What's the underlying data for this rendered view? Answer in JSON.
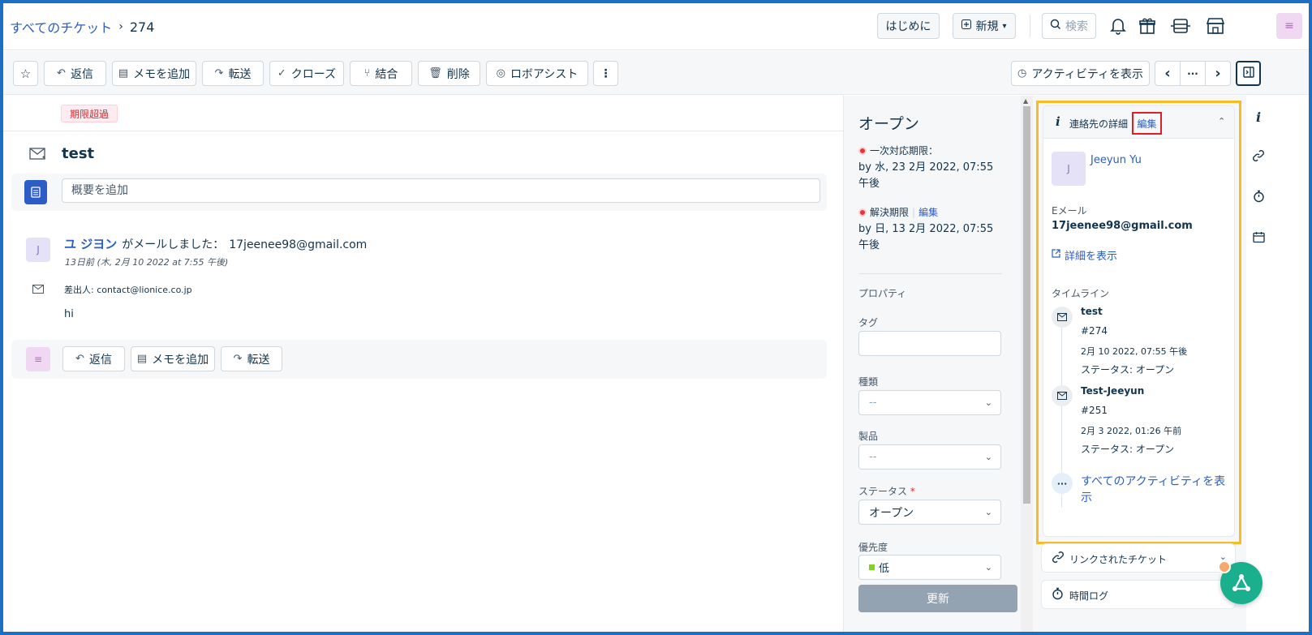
{
  "breadcrumb": {
    "parent": "すべてのチケット",
    "separator": "›",
    "ticket_id": "274"
  },
  "header": {
    "getting_started": "はじめに",
    "new_label": "新規",
    "search_label": "検索",
    "user_initial": "≡"
  },
  "toolbar": {
    "reply": "返信",
    "add_note": "メモを追加",
    "forward": "転送",
    "close": "クローズ",
    "merge": "結合",
    "delete": "削除",
    "robo_assist": "ロボアシスト",
    "more": "⋮",
    "show_activity": "アクティビティを表示",
    "prev": "‹",
    "ellipsis": "···",
    "next": "›"
  },
  "ticket": {
    "overdue_badge": "期限超過",
    "subject": "test",
    "summary_placeholder": "概要を追加"
  },
  "message": {
    "avatar_initial": "J",
    "sender_name": "ユ ジヨン",
    "action_text": "がメールしました：",
    "email": "17jeenee98@gmail.com",
    "timestamp": "13日前 (木, 2月 10 2022 at 7:55 午後)",
    "from_line": "差出人: contact@lionice.co.jp",
    "body": "hi"
  },
  "reply_bar": {
    "avatar_initial": "≡",
    "reply": "返信",
    "add_note": "メモを追加",
    "forward": "転送"
  },
  "properties": {
    "status_heading": "オープン",
    "first_response_label": "一次対応期限：",
    "first_response_value": "by 水, 23 2月 2022, 07:55 午後",
    "resolution_label": "解決期限",
    "resolution_edit": "編集",
    "resolution_value": "by 日, 13 2月 2022, 07:55 午後",
    "section_title": "プロパティ",
    "tags_label": "タグ",
    "type_label": "種類",
    "type_value": "--",
    "product_label": "製品",
    "product_value": "--",
    "status_label": "ステータス",
    "required_mark": "*",
    "status_value": "オープン",
    "priority_label": "優先度",
    "priority_value": "低",
    "priority_color": "#7ed321",
    "update_button": "更新"
  },
  "contact": {
    "header_title": "連絡先の詳細",
    "edit_label": "編集",
    "avatar_initial": "J",
    "name": "Jeeyun Yu",
    "email_label": "Eメール",
    "email": "17jeenee98@gmail.com",
    "view_details": "詳細を表示",
    "timeline_label": "タイムライン",
    "timeline": [
      {
        "title": "test",
        "id": "#274",
        "date": "2月 10 2022, 07:55 午後",
        "status": "ステータス: オープン"
      },
      {
        "title": "Test-Jeeyun",
        "id": "#251",
        "date": "2月 3 2022, 01:26 午前",
        "status": "ステータス: オープン"
      }
    ],
    "view_all_activity": "すべてのアクティビティを表示"
  },
  "accordions": {
    "linked_tickets": "リンクされたチケット",
    "time_log": "時間ログ"
  },
  "colors": {
    "accent": "#2c5cc5",
    "highlight_border": "#f5bd21",
    "edit_highlight": "#e11e27",
    "frame_border": "#1d6fc4",
    "fab": "#1ab08e"
  }
}
